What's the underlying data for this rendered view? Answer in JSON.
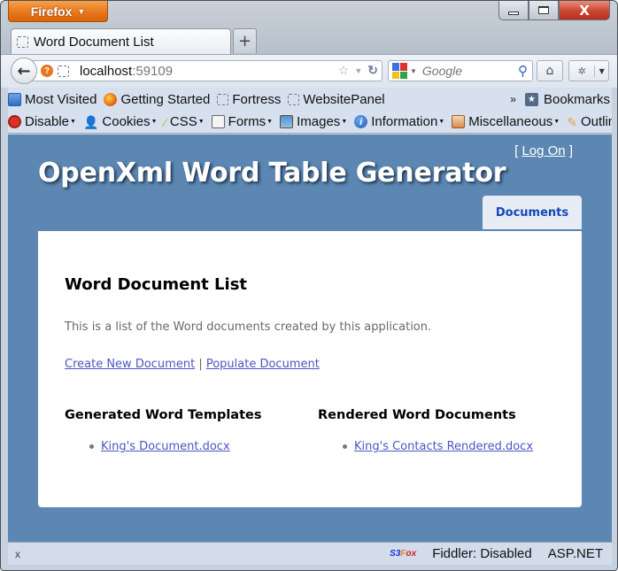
{
  "browser": {
    "app_button": "Firefox",
    "tabs": [
      {
        "title": "Word Document List"
      }
    ],
    "new_tab_label": "+",
    "url": {
      "host": "localhost",
      "port": ":59109"
    },
    "search": {
      "engine": "Google",
      "placeholder": "Google"
    },
    "window_controls": {
      "minimize": "minimize",
      "maximize": "maximize",
      "close": "X"
    }
  },
  "bookmarks_toolbar": {
    "items": [
      {
        "label": "Most Visited",
        "icon": "most-visited-icon"
      },
      {
        "label": "Getting Started",
        "icon": "firefox-icon"
      },
      {
        "label": "Fortress",
        "icon": "page-icon"
      },
      {
        "label": "WebsitePanel",
        "icon": "page-icon"
      }
    ],
    "overflow": "»",
    "bookmarks_label": "Bookmarks"
  },
  "web_developer_toolbar": {
    "items": [
      {
        "label": "Disable",
        "icon": "disable-icon"
      },
      {
        "label": "Cookies",
        "icon": "cookie-icon"
      },
      {
        "label": "CSS",
        "icon": "css-icon"
      },
      {
        "label": "Forms",
        "icon": "forms-icon"
      },
      {
        "label": "Images",
        "icon": "images-icon"
      },
      {
        "label": "Information",
        "icon": "information-icon"
      },
      {
        "label": "Miscellaneous",
        "icon": "miscellaneous-icon"
      },
      {
        "label": "Outline",
        "icon": "outline-icon"
      }
    ]
  },
  "page": {
    "logon": {
      "open": "[",
      "label": "Log On",
      "close": "]"
    },
    "site_title": "OpenXml Word Table Generator",
    "menu": [
      {
        "label": "Documents",
        "active": true
      }
    ],
    "heading": "Word Document List",
    "intro": "This is a list of the Word documents created by this application.",
    "actions": {
      "create": "Create New Document",
      "separator": "|",
      "populate": "Populate Document"
    },
    "templates": {
      "heading": "Generated Word Templates",
      "files": [
        "King's Document.docx"
      ]
    },
    "rendered": {
      "heading": "Rendered Word Documents",
      "files": [
        "King's Contacts Rendered.docx"
      ]
    }
  },
  "status_bar": {
    "close": "x",
    "s3fox": {
      "s3": "S3",
      "f": "F",
      "ox": "ox"
    },
    "fiddler": "Fiddler: Disabled",
    "aspnet": "ASP.NET"
  }
}
